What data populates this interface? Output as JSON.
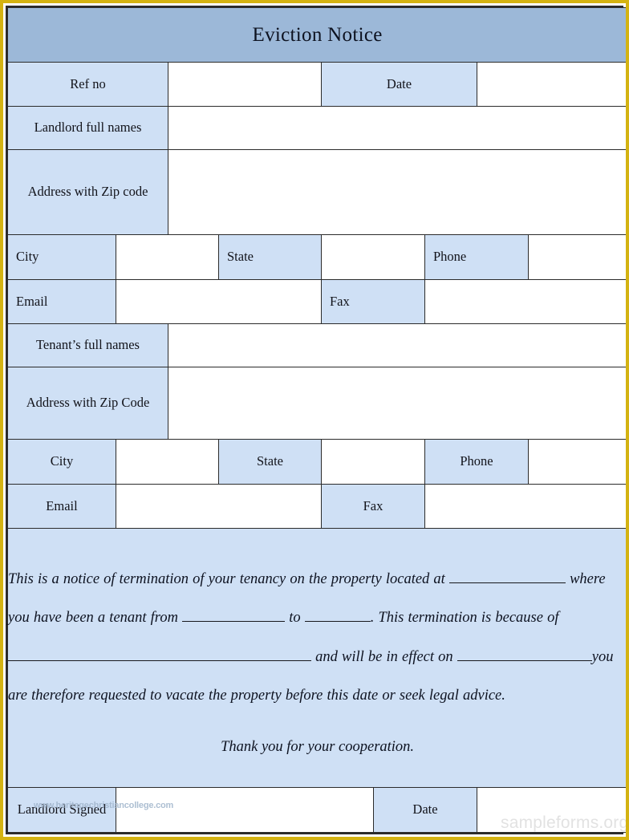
{
  "document": {
    "title": "Eviction Notice"
  },
  "rows": {
    "ref_no_label": "Ref no",
    "ref_no_value": "",
    "date_label": "Date",
    "date_value": "",
    "landlord_names_label": "Landlord full names",
    "landlord_names_value": "",
    "landlord_address_label": "Address with Zip code",
    "landlord_address_value": "",
    "landlord_city_label": "City",
    "landlord_city_value": "",
    "landlord_state_label": "State",
    "landlord_state_value": "",
    "landlord_phone_label": "Phone",
    "landlord_phone_value": "",
    "landlord_email_label": "Email",
    "landlord_email_value": "",
    "landlord_fax_label": "Fax",
    "landlord_fax_value": "",
    "tenant_names_label": "Tenant’s full names",
    "tenant_names_value": "",
    "tenant_address_label": "Address with Zip Code",
    "tenant_address_value": "",
    "tenant_city_label": "City",
    "tenant_city_value": "",
    "tenant_state_label": "State",
    "tenant_state_value": "",
    "tenant_phone_label": "Phone",
    "tenant_phone_value": "",
    "tenant_email_label": "Email",
    "tenant_email_value": "",
    "tenant_fax_label": "Fax",
    "tenant_fax_value": ""
  },
  "body": {
    "seg1": "This is a notice of termination of your tenancy on the property located at",
    "seg2": "where you have been a tenant from",
    "seg3": "to",
    "seg4": ".  This termination is because of",
    "seg5": "and will be in effect on",
    "seg6": "you are therefore requested to vacate the property before this date or seek legal advice.",
    "thanks": "Thank you for your cooperation."
  },
  "signature": {
    "landlord_signed_label": "Landlord Signed",
    "landlord_signed_value": "",
    "date_label": "Date",
    "date_value": ""
  },
  "watermarks": {
    "college": "www.heritagechristiancollege.com",
    "sampleforms": "sampleforms.org"
  },
  "colors": {
    "frame_gold": "#d4b312",
    "title_blue": "#9cb8d8",
    "label_blue": "#cfe0f5",
    "border_dark": "#2b2b2b"
  }
}
